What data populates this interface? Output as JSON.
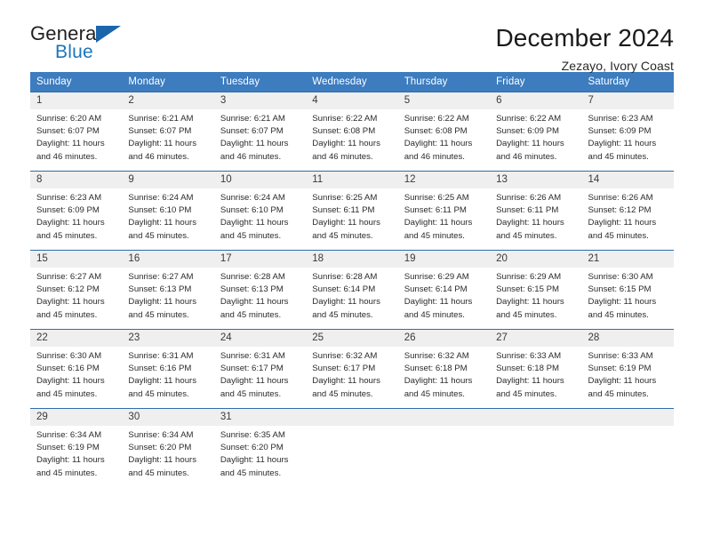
{
  "brand": {
    "name_top": "General",
    "name_bottom": "Blue",
    "flag_icon": "blue-triangle-flag-icon"
  },
  "header": {
    "title": "December 2024",
    "subtitle": "Zezayo, Ivory Coast"
  },
  "colors": {
    "header_blue": "#3c7cbf",
    "row_rule_blue": "#2f6ca8",
    "daynum_band": "#efefef",
    "brand_blue": "#1b75bb"
  },
  "calendar": {
    "weekday_headers": [
      "Sunday",
      "Monday",
      "Tuesday",
      "Wednesday",
      "Thursday",
      "Friday",
      "Saturday"
    ],
    "weeks": [
      [
        {
          "day": "1",
          "sunrise": "Sunrise: 6:20 AM",
          "sunset": "Sunset: 6:07 PM",
          "daylight_1": "Daylight: 11 hours",
          "daylight_2": "and 46 minutes."
        },
        {
          "day": "2",
          "sunrise": "Sunrise: 6:21 AM",
          "sunset": "Sunset: 6:07 PM",
          "daylight_1": "Daylight: 11 hours",
          "daylight_2": "and 46 minutes."
        },
        {
          "day": "3",
          "sunrise": "Sunrise: 6:21 AM",
          "sunset": "Sunset: 6:07 PM",
          "daylight_1": "Daylight: 11 hours",
          "daylight_2": "and 46 minutes."
        },
        {
          "day": "4",
          "sunrise": "Sunrise: 6:22 AM",
          "sunset": "Sunset: 6:08 PM",
          "daylight_1": "Daylight: 11 hours",
          "daylight_2": "and 46 minutes."
        },
        {
          "day": "5",
          "sunrise": "Sunrise: 6:22 AM",
          "sunset": "Sunset: 6:08 PM",
          "daylight_1": "Daylight: 11 hours",
          "daylight_2": "and 46 minutes."
        },
        {
          "day": "6",
          "sunrise": "Sunrise: 6:22 AM",
          "sunset": "Sunset: 6:09 PM",
          "daylight_1": "Daylight: 11 hours",
          "daylight_2": "and 46 minutes."
        },
        {
          "day": "7",
          "sunrise": "Sunrise: 6:23 AM",
          "sunset": "Sunset: 6:09 PM",
          "daylight_1": "Daylight: 11 hours",
          "daylight_2": "and 45 minutes."
        }
      ],
      [
        {
          "day": "8",
          "sunrise": "Sunrise: 6:23 AM",
          "sunset": "Sunset: 6:09 PM",
          "daylight_1": "Daylight: 11 hours",
          "daylight_2": "and 45 minutes."
        },
        {
          "day": "9",
          "sunrise": "Sunrise: 6:24 AM",
          "sunset": "Sunset: 6:10 PM",
          "daylight_1": "Daylight: 11 hours",
          "daylight_2": "and 45 minutes."
        },
        {
          "day": "10",
          "sunrise": "Sunrise: 6:24 AM",
          "sunset": "Sunset: 6:10 PM",
          "daylight_1": "Daylight: 11 hours",
          "daylight_2": "and 45 minutes."
        },
        {
          "day": "11",
          "sunrise": "Sunrise: 6:25 AM",
          "sunset": "Sunset: 6:11 PM",
          "daylight_1": "Daylight: 11 hours",
          "daylight_2": "and 45 minutes."
        },
        {
          "day": "12",
          "sunrise": "Sunrise: 6:25 AM",
          "sunset": "Sunset: 6:11 PM",
          "daylight_1": "Daylight: 11 hours",
          "daylight_2": "and 45 minutes."
        },
        {
          "day": "13",
          "sunrise": "Sunrise: 6:26 AM",
          "sunset": "Sunset: 6:11 PM",
          "daylight_1": "Daylight: 11 hours",
          "daylight_2": "and 45 minutes."
        },
        {
          "day": "14",
          "sunrise": "Sunrise: 6:26 AM",
          "sunset": "Sunset: 6:12 PM",
          "daylight_1": "Daylight: 11 hours",
          "daylight_2": "and 45 minutes."
        }
      ],
      [
        {
          "day": "15",
          "sunrise": "Sunrise: 6:27 AM",
          "sunset": "Sunset: 6:12 PM",
          "daylight_1": "Daylight: 11 hours",
          "daylight_2": "and 45 minutes."
        },
        {
          "day": "16",
          "sunrise": "Sunrise: 6:27 AM",
          "sunset": "Sunset: 6:13 PM",
          "daylight_1": "Daylight: 11 hours",
          "daylight_2": "and 45 minutes."
        },
        {
          "day": "17",
          "sunrise": "Sunrise: 6:28 AM",
          "sunset": "Sunset: 6:13 PM",
          "daylight_1": "Daylight: 11 hours",
          "daylight_2": "and 45 minutes."
        },
        {
          "day": "18",
          "sunrise": "Sunrise: 6:28 AM",
          "sunset": "Sunset: 6:14 PM",
          "daylight_1": "Daylight: 11 hours",
          "daylight_2": "and 45 minutes."
        },
        {
          "day": "19",
          "sunrise": "Sunrise: 6:29 AM",
          "sunset": "Sunset: 6:14 PM",
          "daylight_1": "Daylight: 11 hours",
          "daylight_2": "and 45 minutes."
        },
        {
          "day": "20",
          "sunrise": "Sunrise: 6:29 AM",
          "sunset": "Sunset: 6:15 PM",
          "daylight_1": "Daylight: 11 hours",
          "daylight_2": "and 45 minutes."
        },
        {
          "day": "21",
          "sunrise": "Sunrise: 6:30 AM",
          "sunset": "Sunset: 6:15 PM",
          "daylight_1": "Daylight: 11 hours",
          "daylight_2": "and 45 minutes."
        }
      ],
      [
        {
          "day": "22",
          "sunrise": "Sunrise: 6:30 AM",
          "sunset": "Sunset: 6:16 PM",
          "daylight_1": "Daylight: 11 hours",
          "daylight_2": "and 45 minutes."
        },
        {
          "day": "23",
          "sunrise": "Sunrise: 6:31 AM",
          "sunset": "Sunset: 6:16 PM",
          "daylight_1": "Daylight: 11 hours",
          "daylight_2": "and 45 minutes."
        },
        {
          "day": "24",
          "sunrise": "Sunrise: 6:31 AM",
          "sunset": "Sunset: 6:17 PM",
          "daylight_1": "Daylight: 11 hours",
          "daylight_2": "and 45 minutes."
        },
        {
          "day": "25",
          "sunrise": "Sunrise: 6:32 AM",
          "sunset": "Sunset: 6:17 PM",
          "daylight_1": "Daylight: 11 hours",
          "daylight_2": "and 45 minutes."
        },
        {
          "day": "26",
          "sunrise": "Sunrise: 6:32 AM",
          "sunset": "Sunset: 6:18 PM",
          "daylight_1": "Daylight: 11 hours",
          "daylight_2": "and 45 minutes."
        },
        {
          "day": "27",
          "sunrise": "Sunrise: 6:33 AM",
          "sunset": "Sunset: 6:18 PM",
          "daylight_1": "Daylight: 11 hours",
          "daylight_2": "and 45 minutes."
        },
        {
          "day": "28",
          "sunrise": "Sunrise: 6:33 AM",
          "sunset": "Sunset: 6:19 PM",
          "daylight_1": "Daylight: 11 hours",
          "daylight_2": "and 45 minutes."
        }
      ],
      [
        {
          "day": "29",
          "sunrise": "Sunrise: 6:34 AM",
          "sunset": "Sunset: 6:19 PM",
          "daylight_1": "Daylight: 11 hours",
          "daylight_2": "and 45 minutes."
        },
        {
          "day": "30",
          "sunrise": "Sunrise: 6:34 AM",
          "sunset": "Sunset: 6:20 PM",
          "daylight_1": "Daylight: 11 hours",
          "daylight_2": "and 45 minutes."
        },
        {
          "day": "31",
          "sunrise": "Sunrise: 6:35 AM",
          "sunset": "Sunset: 6:20 PM",
          "daylight_1": "Daylight: 11 hours",
          "daylight_2": "and 45 minutes."
        },
        {
          "day": "",
          "sunrise": "",
          "sunset": "",
          "daylight_1": "",
          "daylight_2": ""
        },
        {
          "day": "",
          "sunrise": "",
          "sunset": "",
          "daylight_1": "",
          "daylight_2": ""
        },
        {
          "day": "",
          "sunrise": "",
          "sunset": "",
          "daylight_1": "",
          "daylight_2": ""
        },
        {
          "day": "",
          "sunrise": "",
          "sunset": "",
          "daylight_1": "",
          "daylight_2": ""
        }
      ]
    ]
  }
}
